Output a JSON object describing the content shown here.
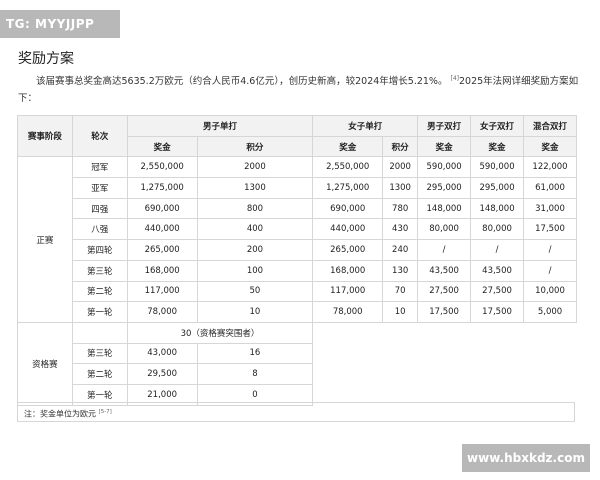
{
  "watermark_top": "TG: MYYJJPP",
  "watermark_bottom": "www.hbxkdz.com",
  "section_title": "奖励方案",
  "intro": {
    "text": "该届赛事总奖金高达5635.2万欧元（约合人民币4.6亿元），创历史新高，较2024年增长5.21%。",
    "ref": "[4]",
    "text2": "2025年法网详细奖励方案如下："
  },
  "table": {
    "head_stage": "赛事阶段",
    "head_round": "轮次",
    "head_ms": "男子单打",
    "head_ws": "女子单打",
    "head_md": "男子双打",
    "head_wd": "女子双打",
    "head_xd": "混合双打",
    "sub_prize": "奖金",
    "sub_points": "积分",
    "main_stage": "正赛",
    "main_rows": [
      {
        "round": "冠军",
        "ms_prize": "2,550,000",
        "ms_points": "2000",
        "ws_prize": "2,550,000",
        "ws_points": "2000",
        "md": "590,000",
        "wd": "590,000",
        "xd": "122,000"
      },
      {
        "round": "亚军",
        "ms_prize": "1,275,000",
        "ms_points": "1300",
        "ws_prize": "1,275,000",
        "ws_points": "1300",
        "md": "295,000",
        "wd": "295,000",
        "xd": "61,000"
      },
      {
        "round": "四强",
        "ms_prize": "690,000",
        "ms_points": "800",
        "ws_prize": "690,000",
        "ws_points": "780",
        "md": "148,000",
        "wd": "148,000",
        "xd": "31,000"
      },
      {
        "round": "八强",
        "ms_prize": "440,000",
        "ms_points": "400",
        "ws_prize": "440,000",
        "ws_points": "430",
        "md": "80,000",
        "wd": "80,000",
        "xd": "17,500"
      },
      {
        "round": "第四轮",
        "ms_prize": "265,000",
        "ms_points": "200",
        "ws_prize": "265,000",
        "ws_points": "240",
        "md": "/",
        "wd": "/",
        "xd": "/"
      },
      {
        "round": "第三轮",
        "ms_prize": "168,000",
        "ms_points": "100",
        "ws_prize": "168,000",
        "ws_points": "130",
        "md": "43,500",
        "wd": "43,500",
        "xd": "/"
      },
      {
        "round": "第二轮",
        "ms_prize": "117,000",
        "ms_points": "50",
        "ws_prize": "117,000",
        "ws_points": "70",
        "md": "27,500",
        "wd": "27,500",
        "xd": "10,000"
      },
      {
        "round": "第一轮",
        "ms_prize": "78,000",
        "ms_points": "10",
        "ws_prize": "78,000",
        "ws_points": "10",
        "md": "17,500",
        "wd": "17,500",
        "xd": "5,000"
      }
    ],
    "qual_stage": "资格赛",
    "qual_header": "30（资格赛突围者）",
    "qual_rows": [
      {
        "round": "第三轮",
        "ms_prize": "43,000",
        "ms_points": "16"
      },
      {
        "round": "第二轮",
        "ms_prize": "29,500",
        "ms_points": "8"
      },
      {
        "round": "第一轮",
        "ms_prize": "21,000",
        "ms_points": "0"
      }
    ]
  },
  "note": {
    "text": "注：奖金单位为欧元",
    "ref": "[5-7]"
  }
}
